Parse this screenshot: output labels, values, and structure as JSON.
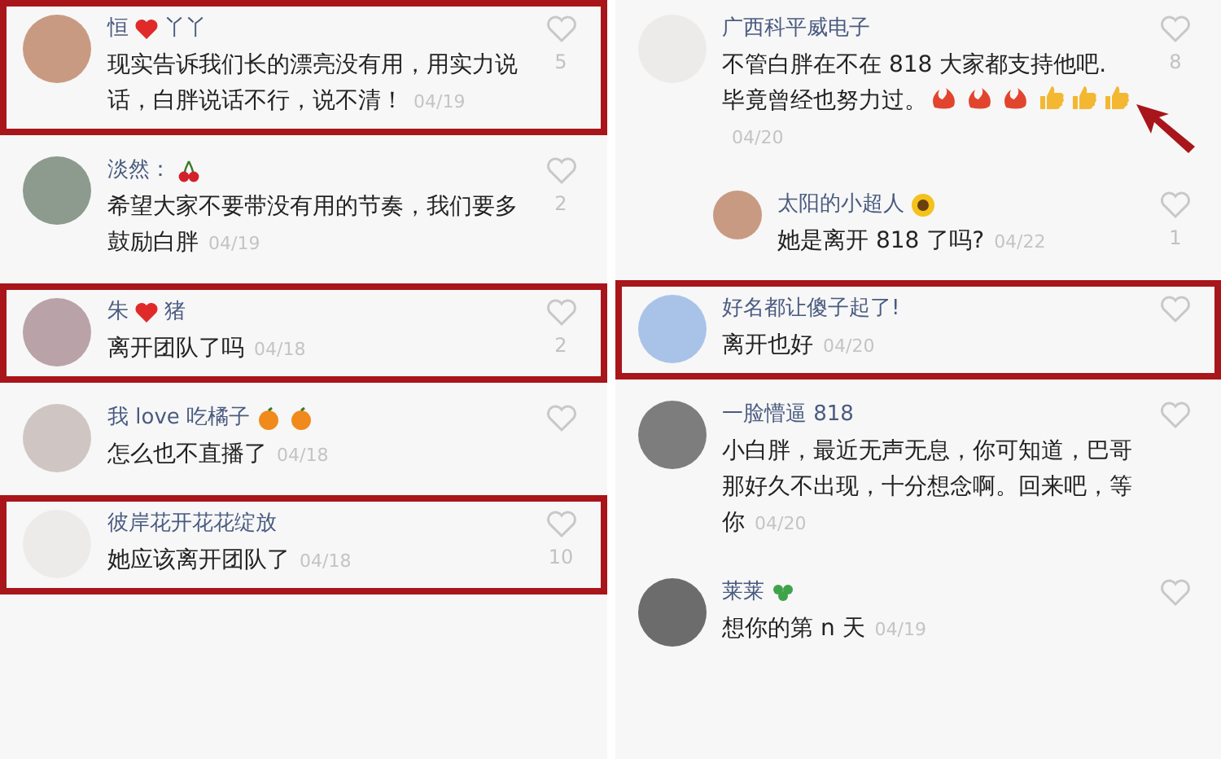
{
  "columns": [
    {
      "comments": [
        {
          "name": [
            {
              "kind": "text",
              "text": "恒"
            },
            {
              "kind": "heart"
            },
            {
              "kind": "text",
              "text": "丫丫"
            }
          ],
          "text": [
            {
              "kind": "text",
              "text": "现实告诉我们长的漂亮没有用，用实力说话，白胖说话不行，说不清！"
            }
          ],
          "date": "04/19",
          "likes": "5",
          "highlighted": true
        },
        {
          "name": [
            {
              "kind": "text",
              "text": "淡然："
            },
            {
              "kind": "cherry"
            }
          ],
          "text": [
            {
              "kind": "text",
              "text": "希望大家不要带没有用的节奏，我们要多鼓励白胖"
            }
          ],
          "date": "04/19",
          "likes": "2",
          "highlighted": false
        },
        {
          "name": [
            {
              "kind": "text",
              "text": "朱"
            },
            {
              "kind": "heart"
            },
            {
              "kind": "text",
              "text": "猪"
            }
          ],
          "text": [
            {
              "kind": "text",
              "text": "离开团队了吗"
            }
          ],
          "date": "04/18",
          "likes": "2",
          "highlighted": true
        },
        {
          "name": [
            {
              "kind": "text",
              "text": "我 love 吃橘子"
            },
            {
              "kind": "orange"
            },
            {
              "kind": "orange"
            }
          ],
          "text": [
            {
              "kind": "text",
              "text": "怎么也不直播了"
            }
          ],
          "date": "04/18",
          "highlighted": false
        },
        {
          "name": [
            {
              "kind": "text",
              "text": "彼岸花开花花绽放"
            }
          ],
          "text": [
            {
              "kind": "text",
              "text": "她应该离开团队了"
            }
          ],
          "date": "04/18",
          "likes": "10",
          "highlighted": true
        }
      ]
    },
    {
      "comments": [
        {
          "name": [
            {
              "kind": "text",
              "text": "广西科平威电子"
            }
          ],
          "text": [
            {
              "kind": "text",
              "text": "不管白胖在不在 818 大家都支持他吧. 毕竟曾经也努力过。"
            },
            {
              "kind": "six"
            },
            {
              "kind": "six"
            },
            {
              "kind": "six"
            },
            {
              "kind": "thumb"
            },
            {
              "kind": "thumb"
            },
            {
              "kind": "thumb"
            }
          ],
          "date": "04/20",
          "likes": "8",
          "highlighted": false,
          "replies": [
            {
              "name": [
                {
                  "kind": "text",
                  "text": "太阳的小超人"
                },
                {
                  "kind": "sunflower"
                }
              ],
              "text": [
                {
                  "kind": "text",
                  "text": "她是离开 818 了吗?"
                }
              ],
              "date": "04/22",
              "likes": "1",
              "highlighted": false
            }
          ]
        },
        {
          "name": [
            {
              "kind": "text",
              "text": "好名都让傻子起了!"
            }
          ],
          "text": [
            {
              "kind": "text",
              "text": "离开也好"
            }
          ],
          "date": "04/20",
          "highlighted": true
        },
        {
          "name": [
            {
              "kind": "text",
              "text": "一脸懵逼 818"
            }
          ],
          "text": [
            {
              "kind": "text",
              "text": "小白胖，最近无声无息，你可知道，巴哥那好久不出现，十分想念啊。回来吧，等你"
            }
          ],
          "date": "04/20",
          "highlighted": false
        },
        {
          "name": [
            {
              "kind": "text",
              "text": "莱莱"
            },
            {
              "kind": "clover"
            }
          ],
          "text": [
            {
              "kind": "text",
              "text": "想你的第 n 天"
            }
          ],
          "date": "04/19",
          "highlighted": false
        }
      ]
    }
  ]
}
